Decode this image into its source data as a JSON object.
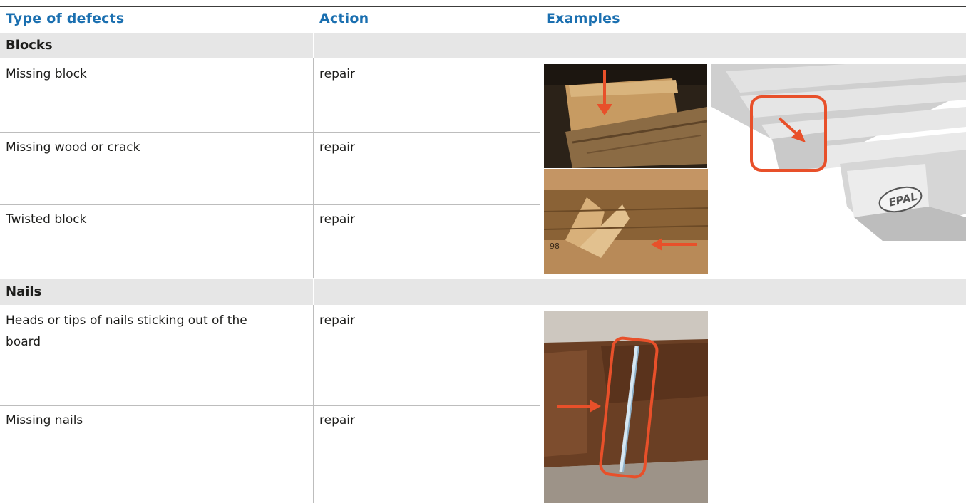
{
  "headers": {
    "type": "Type of defects",
    "action": "Action",
    "examples": "Examples"
  },
  "sections": [
    {
      "title": "Blocks",
      "rows": [
        {
          "defect": "Missing block",
          "action": "repair"
        },
        {
          "defect": "Missing wood or crack",
          "action": "repair"
        },
        {
          "defect": "Twisted block",
          "action": "repair"
        }
      ]
    },
    {
      "title": "Nails",
      "rows": [
        {
          "defect": "Heads or tips of nails sticking out of the board",
          "action": "repair"
        },
        {
          "defect": "Missing nails",
          "action": "repair"
        }
      ]
    }
  ],
  "images": {
    "pallet_logo": "EPAL",
    "crack_stamp": "98"
  },
  "colors": {
    "header_text": "#1a6fb0",
    "section_band": "#e6e6e6",
    "highlight": "#e8502a"
  }
}
